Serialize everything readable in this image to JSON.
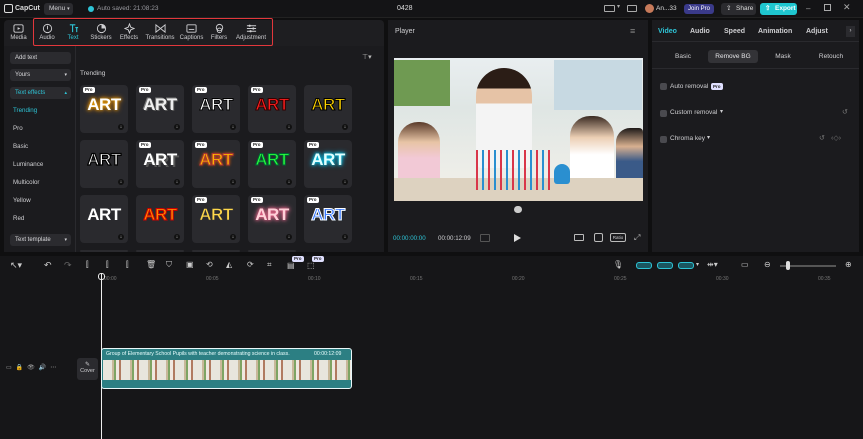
{
  "app": {
    "name": "CapCut",
    "menu_label": "Menu",
    "autosave": "Auto saved: 21:08:23",
    "project_name": "0428",
    "user": "An...33",
    "join_pro": "Join Pro",
    "share": "Share",
    "export": "Export",
    "colors": {
      "accent": "#2ec4d6",
      "highlight": "#e2373c",
      "export_bg": "#1fc6cf"
    }
  },
  "toolbar": {
    "items": [
      {
        "label": "Media",
        "icon": "media-icon"
      },
      {
        "label": "Audio",
        "icon": "audio-icon"
      },
      {
        "label": "Text",
        "icon": "text-icon",
        "active": true
      },
      {
        "label": "Stickers",
        "icon": "stickers-icon"
      },
      {
        "label": "Effects",
        "icon": "effects-icon"
      },
      {
        "label": "Transitions",
        "icon": "transitions-icon"
      },
      {
        "label": "Captions",
        "icon": "captions-icon"
      },
      {
        "label": "Filters",
        "icon": "filters-icon"
      },
      {
        "label": "Adjustment",
        "icon": "adjustment-icon"
      }
    ]
  },
  "text_panel": {
    "add_text": "Add text",
    "yours": "Yours",
    "text_effects": "Text effects",
    "text_template": "Text template",
    "categories": [
      "Trending",
      "Pro",
      "Basic",
      "Luminance",
      "Multicolor",
      "Yellow",
      "Red"
    ],
    "section_title": "Trending",
    "card_text": "ART",
    "pro_label": "Pro",
    "cards": [
      {
        "style": "glow-gold",
        "pro": true
      },
      {
        "style": "silver",
        "pro": true
      },
      {
        "style": "white-outline",
        "pro": true
      },
      {
        "style": "red",
        "pro": true
      },
      {
        "style": "yellow-black",
        "pro": false
      },
      {
        "style": "white-black",
        "pro": false
      },
      {
        "style": "white-gray",
        "pro": true
      },
      {
        "style": "orange-fire",
        "pro": true
      },
      {
        "style": "green-neon",
        "pro": true
      },
      {
        "style": "cyan-glow",
        "pro": true
      },
      {
        "style": "white-plain",
        "pro": false
      },
      {
        "style": "orange-red",
        "pro": false
      },
      {
        "style": "yellow-plain",
        "pro": true
      },
      {
        "style": "pink-glow",
        "pro": true
      },
      {
        "style": "blue-3d",
        "pro": true
      }
    ]
  },
  "player": {
    "title": "Player",
    "time_current": "00:00:00:00",
    "time_total": "00:00:12:09",
    "ratio_label": "Ratio"
  },
  "right_panel": {
    "tabs": [
      "Video",
      "Audio",
      "Speed",
      "Animation",
      "Adjust"
    ],
    "subtabs": [
      "Basic",
      "Remove BG",
      "Mask",
      "Retouch"
    ],
    "auto_removal": "Auto removal",
    "custom_removal": "Custom removal",
    "chroma_key": "Chroma key",
    "pro_badge": "Pro"
  },
  "timeline": {
    "ruler": [
      "00:00",
      "00:05",
      "00:10",
      "00:15",
      "00:20",
      "00:25",
      "00:30",
      "00:35"
    ],
    "clip_title": "Group of Elementary School Pupils with teacher demonstrating science in class.",
    "clip_duration": "00:00:12:09",
    "cover_label": "Cover",
    "pro_labels": [
      "Pro",
      "Pro"
    ]
  }
}
